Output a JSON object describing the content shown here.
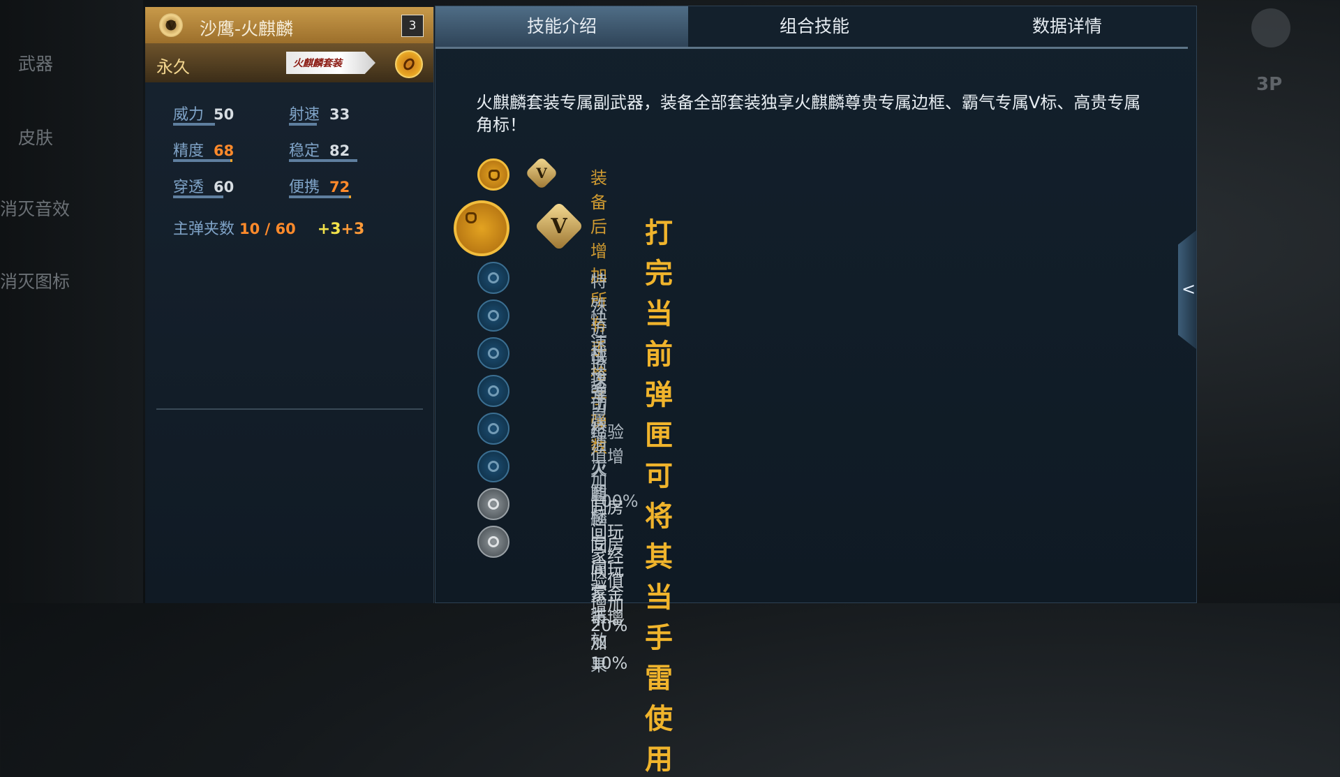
{
  "left_nav": [
    "武器",
    "皮肤",
    "消灭音效",
    "消灭图标"
  ],
  "weapon": {
    "badge": "V",
    "name": "沙鹰-火麒麟",
    "level": "3",
    "duration": "永久",
    "suit_tag": "火麒麟套装",
    "stats": [
      {
        "label": "威力",
        "value": "50",
        "level": 0.5,
        "highlight": false
      },
      {
        "label": "射速",
        "value": "33",
        "level": 0.33,
        "highlight": false
      },
      {
        "label": "精度",
        "value": "68",
        "level": 0.68,
        "highlight": true
      },
      {
        "label": "稳定",
        "value": "82",
        "level": 0.82,
        "highlight": false
      },
      {
        "label": "穿透",
        "value": "60",
        "level": 0.6,
        "highlight": false
      },
      {
        "label": "便携",
        "value": "72",
        "level": 0.72,
        "highlight": true
      }
    ],
    "ammo": {
      "label": "主弹夹数",
      "value": "10 / 60",
      "bonus1": "+3",
      "bonus2": "+3"
    }
  },
  "tabs": [
    "技能介绍",
    "组合技能",
    "数据详情"
  ],
  "active_tab": 0,
  "description": "火麒麟套装专属副武器，装备全部套装独享火麒麟尊贵专属边框、霸气专属V标、高贵专属角标！",
  "skills": [
    {
      "text": "装备后增加所有手枪子弹数",
      "icon": "bullet-icon",
      "tier": "gold"
    },
    {
      "text": "打完当前弹匣可将其当手雷使用",
      "icon": "grenade-icon",
      "tier": "highlight"
    },
    {
      "text": "特殊近战攻击",
      "icon": "melee-icon",
      "tier": "blue"
    },
    {
      "text": "快速换弹",
      "icon": "reload-icon",
      "tier": "blue"
    },
    {
      "text": "快速切枪",
      "icon": "switch-icon",
      "tier": "blue"
    },
    {
      "text": "专属消灭图标",
      "icon": "kill-icon",
      "tier": "blue"
    },
    {
      "text": "经验值增加100%",
      "icon": "exp-icon",
      "tier": "blue"
    },
    {
      "text": "火麒麟专属套装效果",
      "icon": "suit-icon",
      "tier": "blue"
    },
    {
      "text": "同房间玩家经验值增加20%",
      "icon": "room-exp-icon",
      "tier": "gray"
    },
    {
      "text": "同房间玩家金币增加10%",
      "icon": "room-coin-icon",
      "tier": "gray"
    }
  ],
  "side_handle": "<",
  "view_toggle": "3P"
}
